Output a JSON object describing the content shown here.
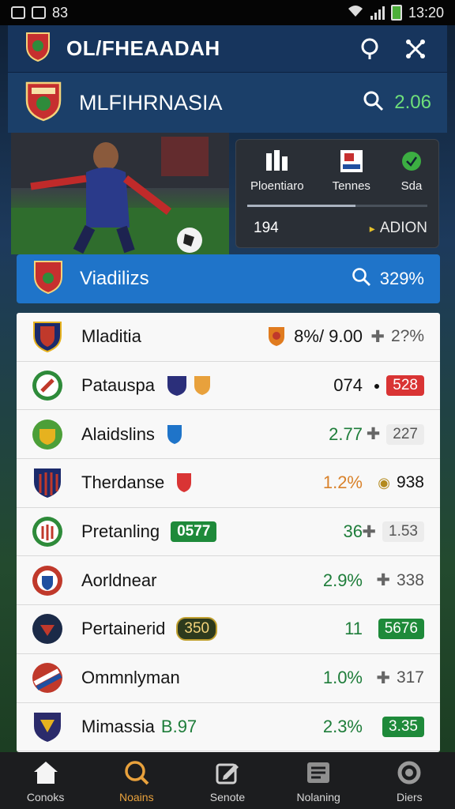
{
  "status_bar": {
    "left": "83",
    "time": "13:20"
  },
  "header": {
    "title": "OL/FHEAADAH",
    "icons": [
      "location-icon",
      "share-icon"
    ]
  },
  "subheader": {
    "title": "MLFIHRNASIA",
    "score": "2.06"
  },
  "hero_panel": {
    "tabs": [
      {
        "label": "Ploentiaro",
        "icon": "stats-icon"
      },
      {
        "label": "Tennes",
        "icon": "table-icon"
      },
      {
        "label": "Sda",
        "icon": "ball-icon"
      }
    ],
    "value": "194",
    "action": "ADION"
  },
  "section": {
    "title": "Viadilizs",
    "value": "329%"
  },
  "teams": [
    {
      "name": "Mladitia",
      "value": "8%/ 9.00",
      "value_color": "#111111",
      "opt": "2?%",
      "badge": "",
      "crest_colors": [
        "#c0392b",
        "#1b2a6b"
      ]
    },
    {
      "name": "Patauspa",
      "value": "074",
      "value_color": "#111111",
      "opt": "528",
      "badge": "",
      "crest_colors": [
        "#2e8b3a",
        "#c0392b"
      ]
    },
    {
      "name": "Alaidslins",
      "value": "2.77",
      "value_color": "#1e7d3a",
      "opt": "227",
      "badge": "",
      "crest_colors": [
        "#4c9f38",
        "#e6b21f"
      ]
    },
    {
      "name": "Therdanse",
      "value": "1.2%",
      "value_color": "#d9822b",
      "opt": "938",
      "badge": "",
      "crest_colors": [
        "#1b2a6b",
        "#c0392b"
      ]
    },
    {
      "name": "Pretanling",
      "value": "36",
      "value_color": "#1e7d3a",
      "opt": "1.53",
      "badge": "0577",
      "crest_colors": [
        "#2e8b3a",
        "#c0392b"
      ]
    },
    {
      "name": "Aorldnear",
      "value": "2.9%",
      "value_color": "#1e7d3a",
      "opt": "338",
      "badge": "",
      "crest_colors": [
        "#c0392b",
        "#1f4fa0"
      ]
    },
    {
      "name": "Pertainerid",
      "value": "11",
      "value_color": "#1e7d3a",
      "opt": "5676",
      "badge": "350",
      "crest_colors": [
        "#1b2a48",
        "#c0392b"
      ]
    },
    {
      "name": "Ommnlyman",
      "value": "1.0%",
      "value_color": "#1e7d3a",
      "opt": "317",
      "badge": "",
      "crest_colors": [
        "#c0392b",
        "#1f4fa0"
      ]
    },
    {
      "name": "Mimassia",
      "value": "2.3%",
      "value_color": "#1e7d3a",
      "opt": "3.35",
      "badge": "B.97",
      "crest_colors": [
        "#2b2b6b",
        "#e6b21f"
      ]
    }
  ],
  "bottom_nav": [
    {
      "label": "Conoks",
      "icon": "home-icon",
      "active": false
    },
    {
      "label": "Noains",
      "icon": "search-icon",
      "active": true
    },
    {
      "label": "Senote",
      "icon": "edit-icon",
      "active": false
    },
    {
      "label": "Nolaning",
      "icon": "list-icon",
      "active": false
    },
    {
      "label": "Diers",
      "icon": "refresh-icon",
      "active": false
    }
  ]
}
